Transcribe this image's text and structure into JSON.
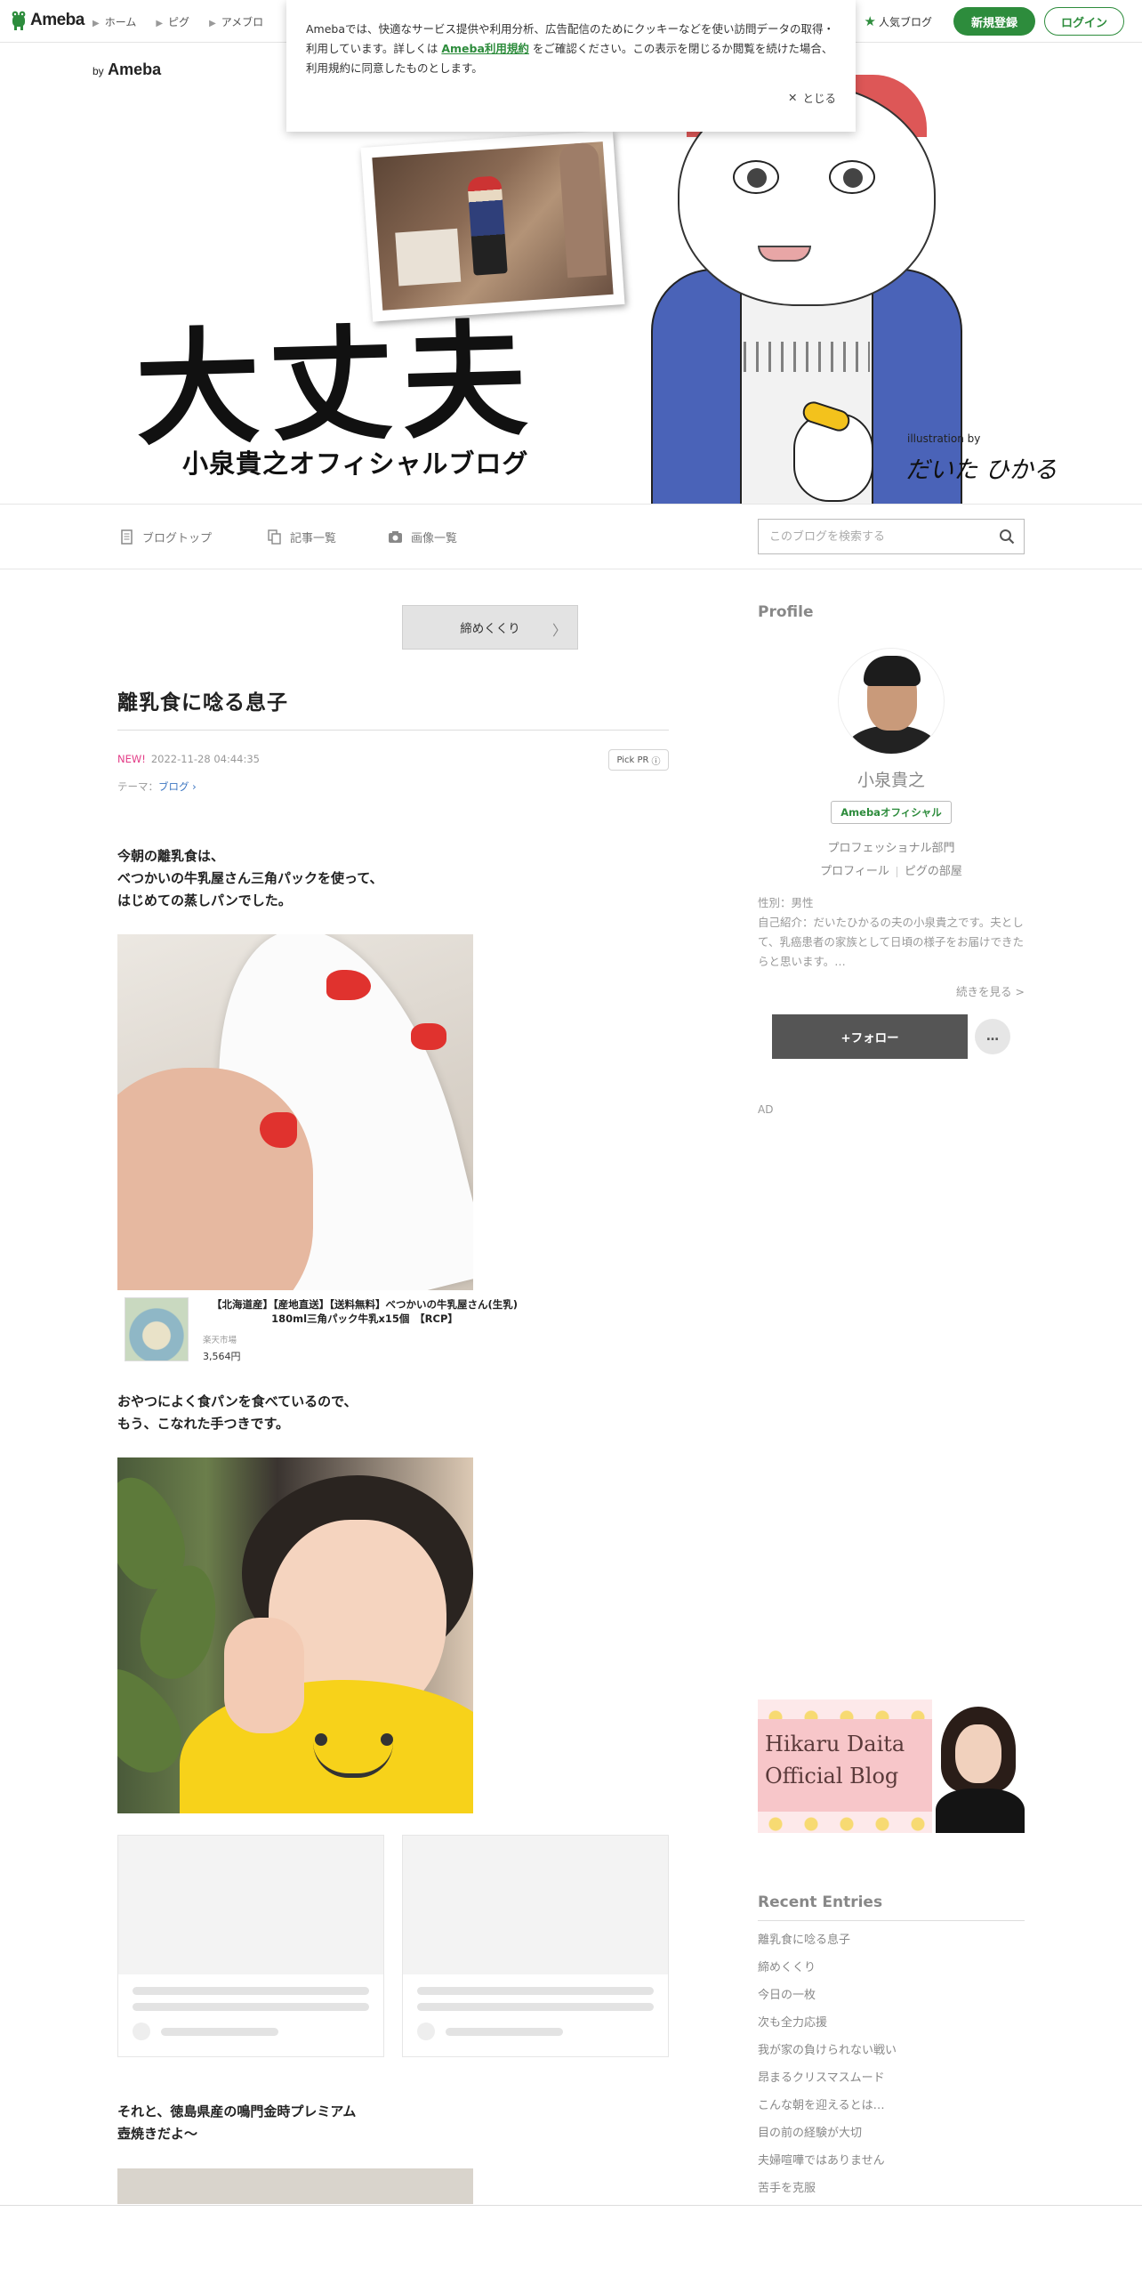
{
  "globalbar": {
    "logo_text": "Ameba",
    "nav": [
      "ホーム",
      "ピグ",
      "アメブロ"
    ],
    "popular": "人気ブログ",
    "register": "新規登録",
    "login": "ログイン"
  },
  "cookie": {
    "text_before": "Amebaでは、快適なサービス提供や利用分析、広告配信のためにクッキーなどを使い訪問データの取得・利用しています。詳しくは ",
    "link": "Ameba利用規約",
    "text_after": " をご確認ください。この表示を閉じるか閲覧を続けた場合、利用規約に同意したものとします。",
    "close": "とじる"
  },
  "banner": {
    "by": "by",
    "ameba": "Ameba",
    "title": "大丈夫",
    "subtitle": "小泉貴之オフィシャルブログ",
    "illustration_by": "illustration by",
    "signature": "だいた ひかる"
  },
  "blogmenu": {
    "top": "ブログトップ",
    "entries": "記事一覧",
    "images": "画像一覧",
    "search_placeholder": "このブログを検索する"
  },
  "entry": {
    "prev_label": "締めくくり",
    "title": "離乳食に唸る息子",
    "new_badge": "NEW!",
    "date": "2022-11-28 04:44:35",
    "pick_pr": "Pick PR",
    "theme_label": "テーマ：",
    "theme": "ブログ",
    "para1": "今朝の離乳食は、\nべつかいの牛乳屋さん三角パックを使って、\nはじめての蒸しパンでした。",
    "product": {
      "name": "【北海道産】【産地直送】【送料無料】べつかいの牛乳屋さん(生乳) 180ml三角パック牛乳x15個　【RCP】",
      "shop": "楽天市場",
      "price": "3,564円"
    },
    "para2": "おやつによく食パンを食べているので、\nもう、こなれた手つきです。",
    "para3": "それと、徳島県産の鳴門金時プレミアム\n壺焼きだよ〜"
  },
  "sidebar": {
    "profile_heading": "Profile",
    "name": "小泉貴之",
    "official_badge": "Amebaオフィシャル",
    "department": "プロフェッショナル部門",
    "profile_link": "プロフィール",
    "pig_link": "ピグの部屋",
    "gender": "性別：男性",
    "intro": "自己紹介：だいたひかるの夫の小泉貴之です。夫として、乳癌患者の家族として日頃の様子をお届けできたらと思います。…",
    "more": "続きを見る >",
    "follow": "+フォロー",
    "more_menu": "…",
    "ad": "AD",
    "hikaru_line1": "Hikaru Daita",
    "hikaru_line2": "Official Blog",
    "recent_heading": "Recent Entries",
    "recent": [
      "離乳食に唸る息子",
      "締めくくり",
      "今日の一枚",
      "次も全力応援",
      "我が家の負けられない戦い",
      "昂まるクリスマスムード",
      "こんな朝を迎えるとは…",
      "目の前の経験が大切",
      "夫婦喧嘩ではありません",
      "苦手を克服"
    ]
  },
  "colors": {
    "brand_green": "#2d8c3c",
    "new_pink": "#e33d87",
    "link_blue": "#3b75c1"
  }
}
